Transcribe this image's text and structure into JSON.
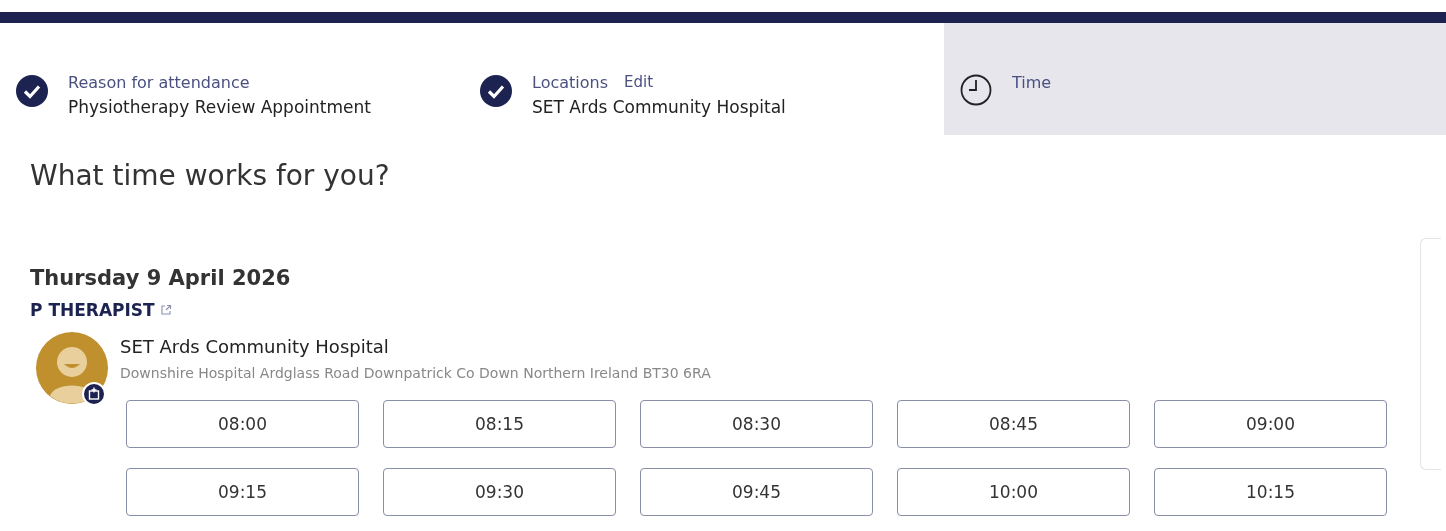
{
  "steps": [
    {
      "kind": "done",
      "label": "Reason for attendance",
      "value": "Physiotherapy Review Appointment",
      "selected": false
    },
    {
      "kind": "done",
      "label": "Locations",
      "edit": "Edit",
      "value": "SET Ards Community Hospital",
      "selected": false
    },
    {
      "kind": "current",
      "label": "Time",
      "selected": true
    }
  ],
  "heading": "What time works for you?",
  "date": "Thursday 9 April 2026",
  "clinician": "P THERAPIST",
  "location": {
    "name": "SET Ards Community Hospital",
    "address": "Downshire Hospital Ardglass Road Downpatrick Co Down Northern Ireland BT30 6RA"
  },
  "slots": [
    "08:00",
    "08:15",
    "08:30",
    "08:45",
    "09:00",
    "09:15",
    "09:30",
    "09:45",
    "10:00",
    "10:15"
  ]
}
